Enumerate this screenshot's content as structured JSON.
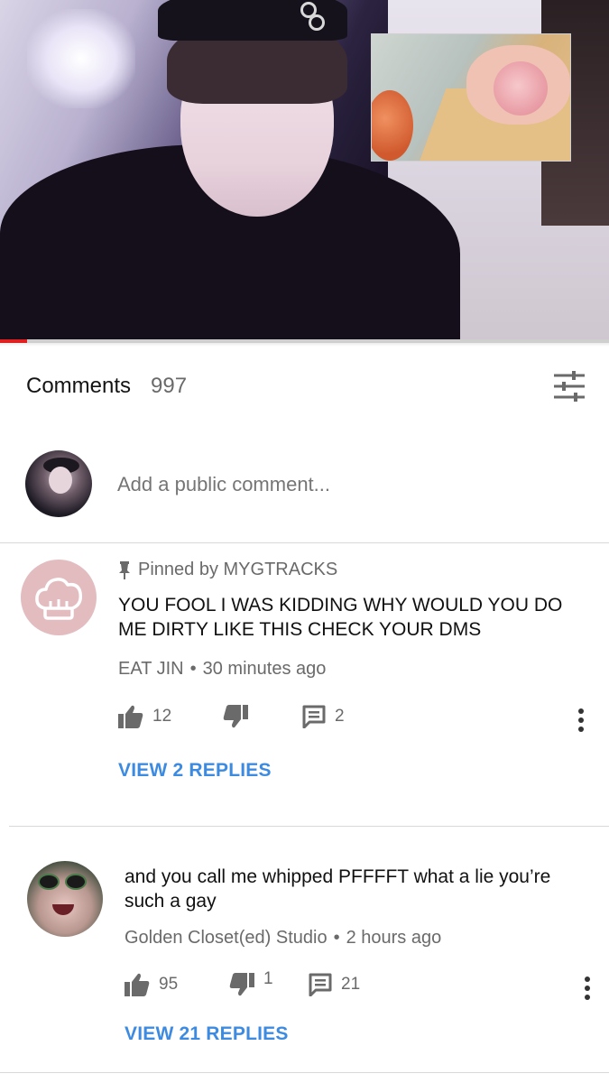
{
  "video": {
    "progress_fraction": 0.045
  },
  "comments_header": {
    "title": "Comments",
    "count": "997",
    "sort_icon": "sort-options-icon"
  },
  "add_comment": {
    "placeholder": "Add a public comment..."
  },
  "comments": [
    {
      "pinned_label": "Pinned by MYGTRACKS",
      "text": "YOU FOOL I WAS KIDDING WHY WOULD YOU DO ME DIRTY LIKE THIS CHECK YOUR DMS",
      "author": "EAT JIN",
      "time": "30 minutes ago",
      "likes": "12",
      "dislikes": "",
      "replies": "2",
      "view_replies_label": "VIEW 2 REPLIES"
    },
    {
      "text": "and you call me whipped PFFFFT what a lie you’re such a gay",
      "author": "Golden Closet(ed) Studio",
      "time": "2 hours ago",
      "likes": "95",
      "dislikes": "1",
      "replies": "21",
      "view_replies_label": "VIEW 21 REPLIES"
    }
  ],
  "colors": {
    "accent_link": "#3d8be0",
    "progress_red": "#e02020",
    "muted_text": "#6a6a6a"
  }
}
